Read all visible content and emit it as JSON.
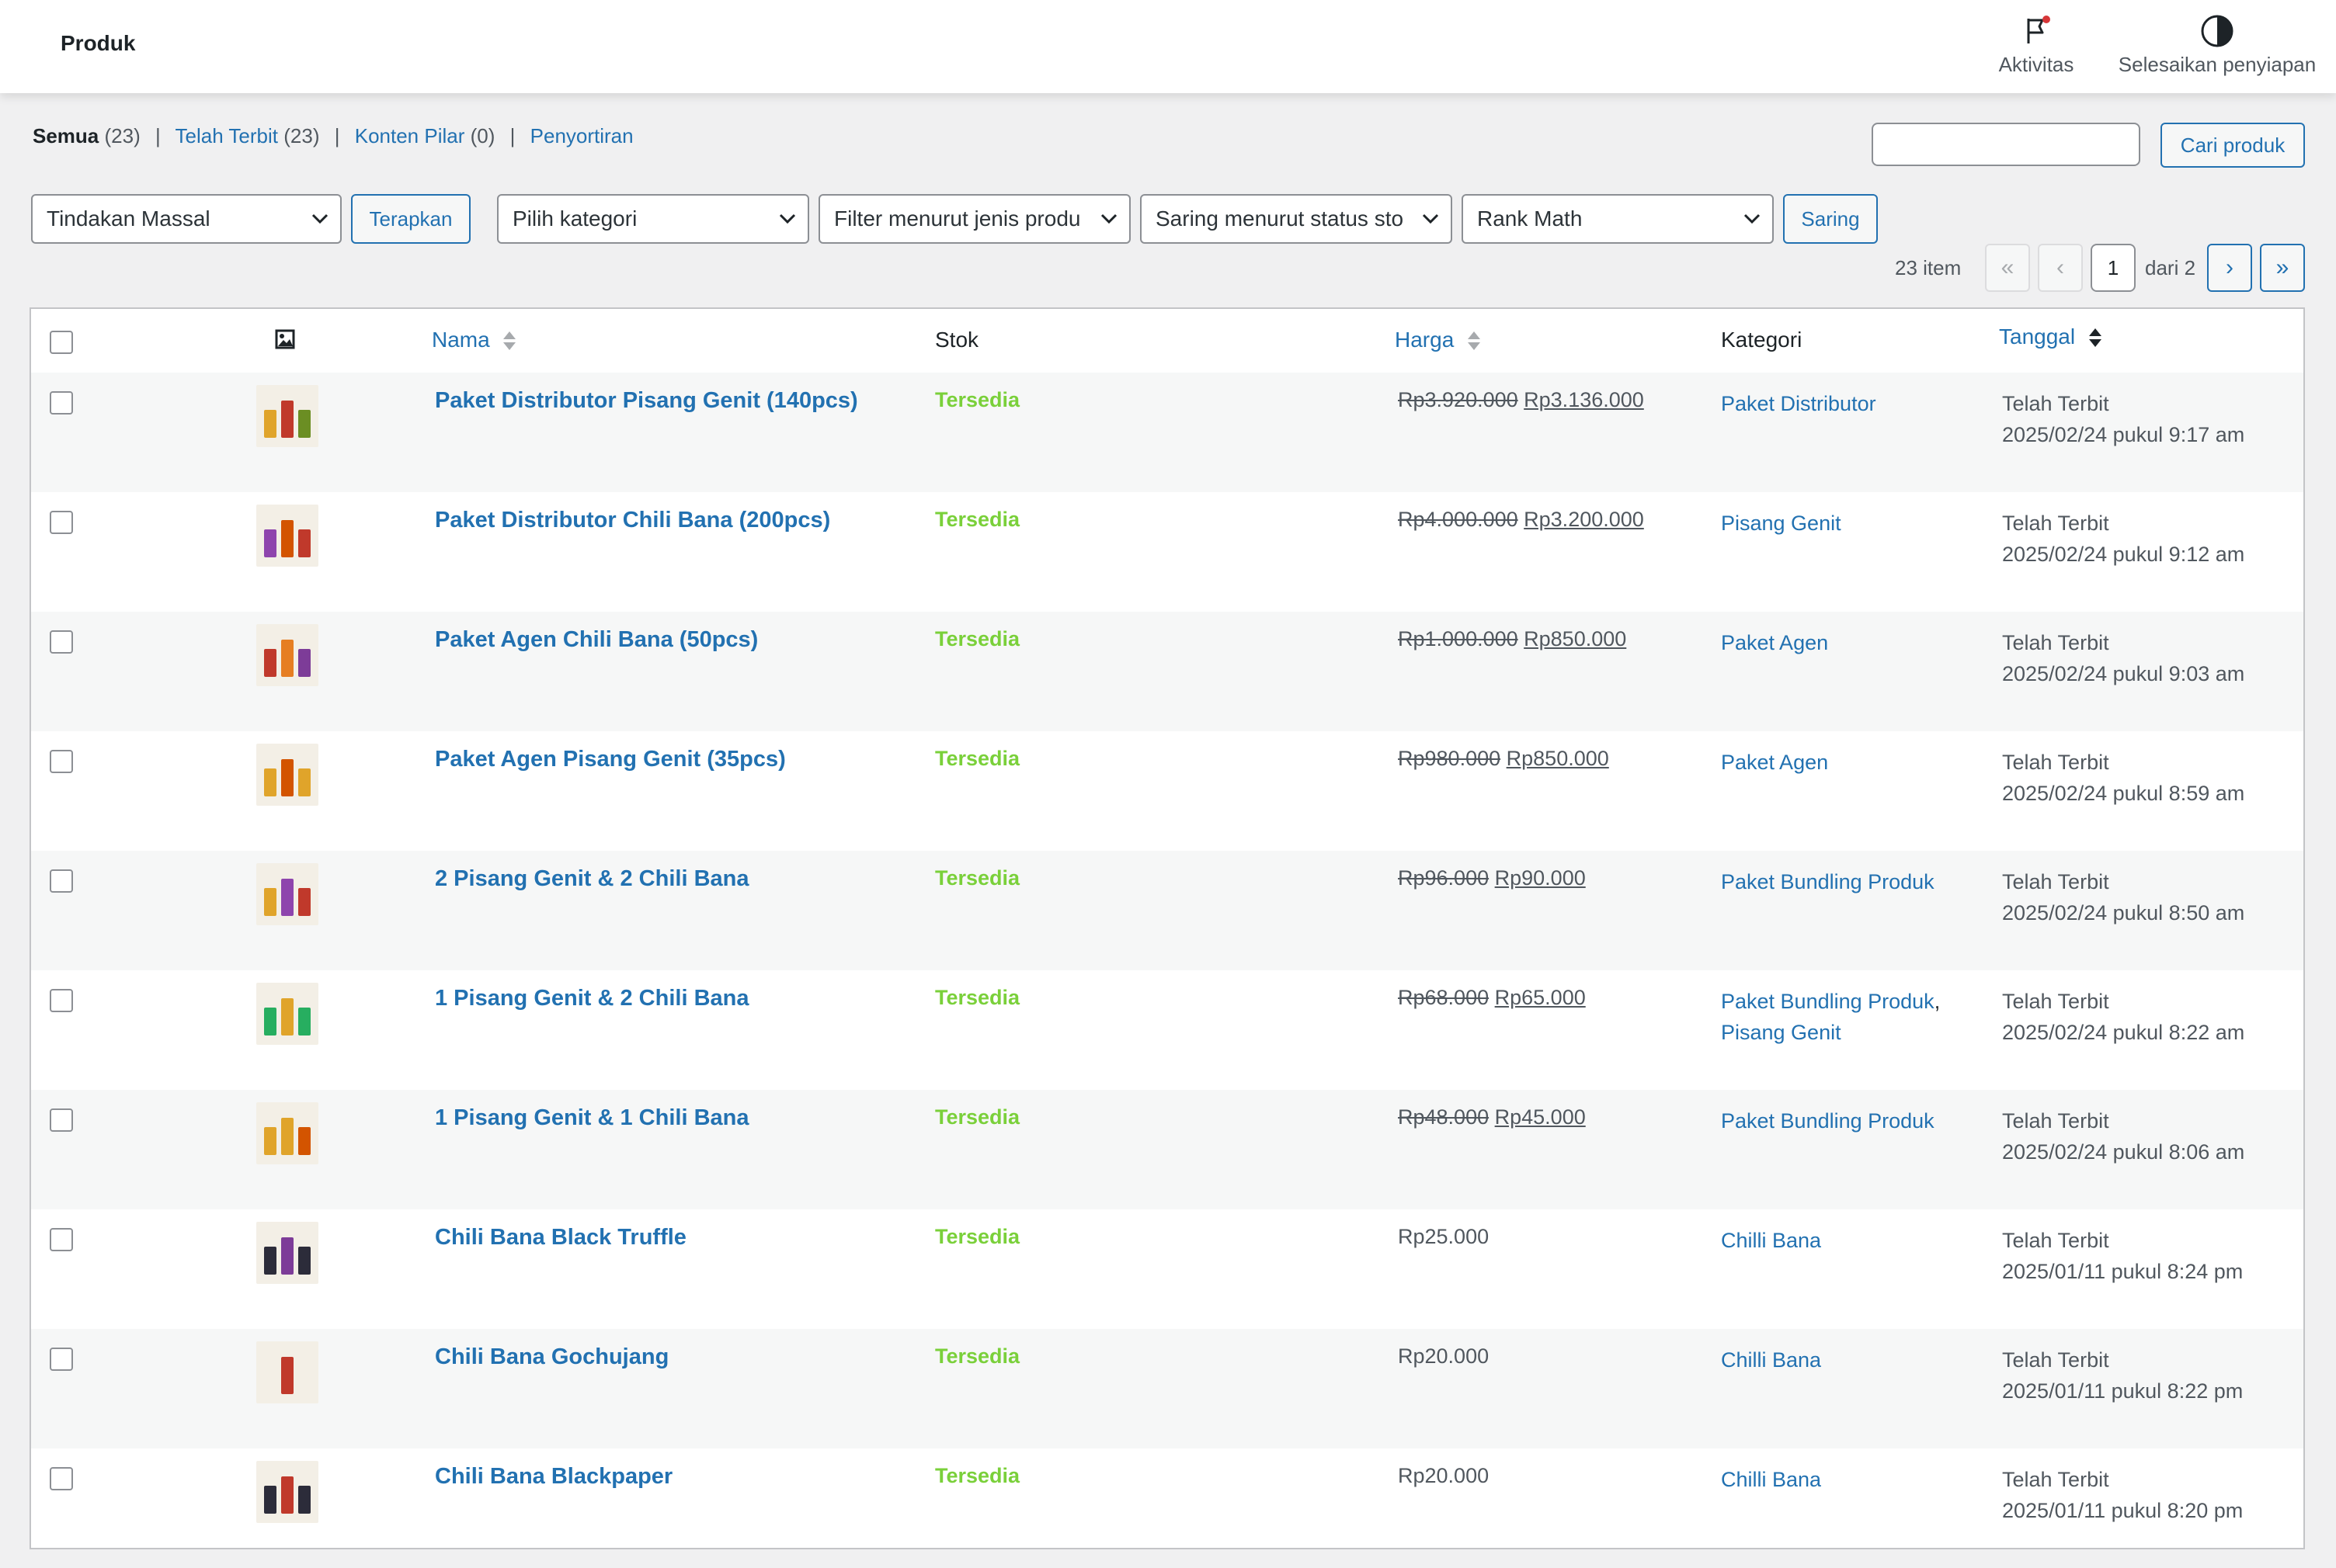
{
  "header": {
    "title": "Produk",
    "activity_label": "Aktivitas",
    "setup_label": "Selesaikan penyiapan"
  },
  "views": {
    "all": {
      "label": "Semua",
      "count": "(23)"
    },
    "published": {
      "label": "Telah Terbit",
      "count": "(23)"
    },
    "pillar": {
      "label": "Konten Pilar",
      "count": "(0)"
    },
    "sorting": {
      "label": "Penyortiran"
    }
  },
  "search": {
    "button_label": "Cari produk",
    "value": ""
  },
  "filters": {
    "bulk_action": "Tindakan Massal",
    "apply_label": "Terapkan",
    "category": "Pilih kategori",
    "product_type": "Filter menurut jenis produ",
    "stock_status": "Saring menurut status sto",
    "rank_math": "Rank Math",
    "filter_label": "Saring"
  },
  "pagination": {
    "count": "23 item",
    "first": "«",
    "prev": "‹",
    "current": "1",
    "of": "dari 2",
    "next": "›",
    "last": "»"
  },
  "columns": {
    "name": "Nama",
    "stock": "Stok",
    "price": "Harga",
    "category": "Kategori",
    "date": "Tanggal"
  },
  "products": [
    {
      "name": "Paket Distributor Pisang Genit (140pcs)",
      "stock": "Tersedia",
      "regular_price": "Rp3.920.000",
      "sale_price": "Rp3.136.000",
      "categories": [
        "Paket Distributor"
      ],
      "status": "Telah Terbit",
      "date": "2025/02/24 pukul 9:17 am",
      "thumb_colors": [
        "#e0a42a",
        "#c0392b",
        "#6b8e23"
      ]
    },
    {
      "name": "Paket Distributor Chili Bana (200pcs)",
      "stock": "Tersedia",
      "regular_price": "Rp4.000.000",
      "sale_price": "Rp3.200.000",
      "categories": [
        "Pisang Genit"
      ],
      "status": "Telah Terbit",
      "date": "2025/02/24 pukul 9:12 am",
      "thumb_colors": [
        "#8e44ad",
        "#d35400",
        "#c0392b"
      ]
    },
    {
      "name": "Paket Agen Chili Bana (50pcs)",
      "stock": "Tersedia",
      "regular_price": "Rp1.000.000",
      "sale_price": "Rp850.000",
      "categories": [
        "Paket Agen"
      ],
      "status": "Telah Terbit",
      "date": "2025/02/24 pukul 9:03 am",
      "thumb_colors": [
        "#c0392b",
        "#e67e22",
        "#7d3c98"
      ]
    },
    {
      "name": "Paket Agen Pisang Genit (35pcs)",
      "stock": "Tersedia",
      "regular_price": "Rp980.000",
      "sale_price": "Rp850.000",
      "categories": [
        "Paket Agen"
      ],
      "status": "Telah Terbit",
      "date": "2025/02/24 pukul 8:59 am",
      "thumb_colors": [
        "#e0a42a",
        "#d35400",
        "#e0a42a"
      ]
    },
    {
      "name": "2 Pisang Genit & 2 Chili Bana",
      "stock": "Tersedia",
      "regular_price": "Rp96.000",
      "sale_price": "Rp90.000",
      "categories": [
        "Paket Bundling Produk"
      ],
      "status": "Telah Terbit",
      "date": "2025/02/24 pukul 8:50 am",
      "thumb_colors": [
        "#e0a42a",
        "#8e44ad",
        "#c0392b"
      ]
    },
    {
      "name": "1 Pisang Genit & 2 Chili Bana",
      "stock": "Tersedia",
      "regular_price": "Rp68.000",
      "sale_price": "Rp65.000",
      "categories": [
        "Paket Bundling Produk",
        "Pisang Genit"
      ],
      "status": "Telah Terbit",
      "date": "2025/02/24 pukul 8:22 am",
      "thumb_colors": [
        "#27ae60",
        "#e0a42a",
        "#27ae60"
      ]
    },
    {
      "name": "1 Pisang Genit & 1 Chili Bana",
      "stock": "Tersedia",
      "regular_price": "Rp48.000",
      "sale_price": "Rp45.000",
      "categories": [
        "Paket Bundling Produk"
      ],
      "status": "Telah Terbit",
      "date": "2025/02/24 pukul 8:06 am",
      "thumb_colors": [
        "#e0a42a",
        "#e0a42a",
        "#d35400"
      ]
    },
    {
      "name": "Chili Bana Black Truffle",
      "stock": "Tersedia",
      "regular_price": "",
      "sale_price": "Rp25.000",
      "categories": [
        "Chilli Bana"
      ],
      "status": "Telah Terbit",
      "date": "2025/01/11 pukul 8:24 pm",
      "thumb_colors": [
        "#2c2c3a",
        "#7d3c98",
        "#2c2c3a"
      ]
    },
    {
      "name": "Chili Bana Gochujang",
      "stock": "Tersedia",
      "regular_price": "",
      "sale_price": "Rp20.000",
      "categories": [
        "Chilli Bana"
      ],
      "status": "Telah Terbit",
      "date": "2025/01/11 pukul 8:22 pm",
      "thumb_colors": [
        "#f3efe6",
        "#c0392b",
        "#f3efe6"
      ]
    },
    {
      "name": "Chili Bana Blackpaper",
      "stock": "Tersedia",
      "regular_price": "",
      "sale_price": "Rp20.000",
      "categories": [
        "Chilli Bana"
      ],
      "status": "Telah Terbit",
      "date": "2025/01/11 pukul 8:20 pm",
      "thumb_colors": [
        "#2c2c3a",
        "#c0392b",
        "#2c2c3a"
      ]
    }
  ],
  "colors": {
    "link": "#2271b1",
    "in_stock": "#7ad03a",
    "text": "#1d2327",
    "muted": "#50575e"
  }
}
